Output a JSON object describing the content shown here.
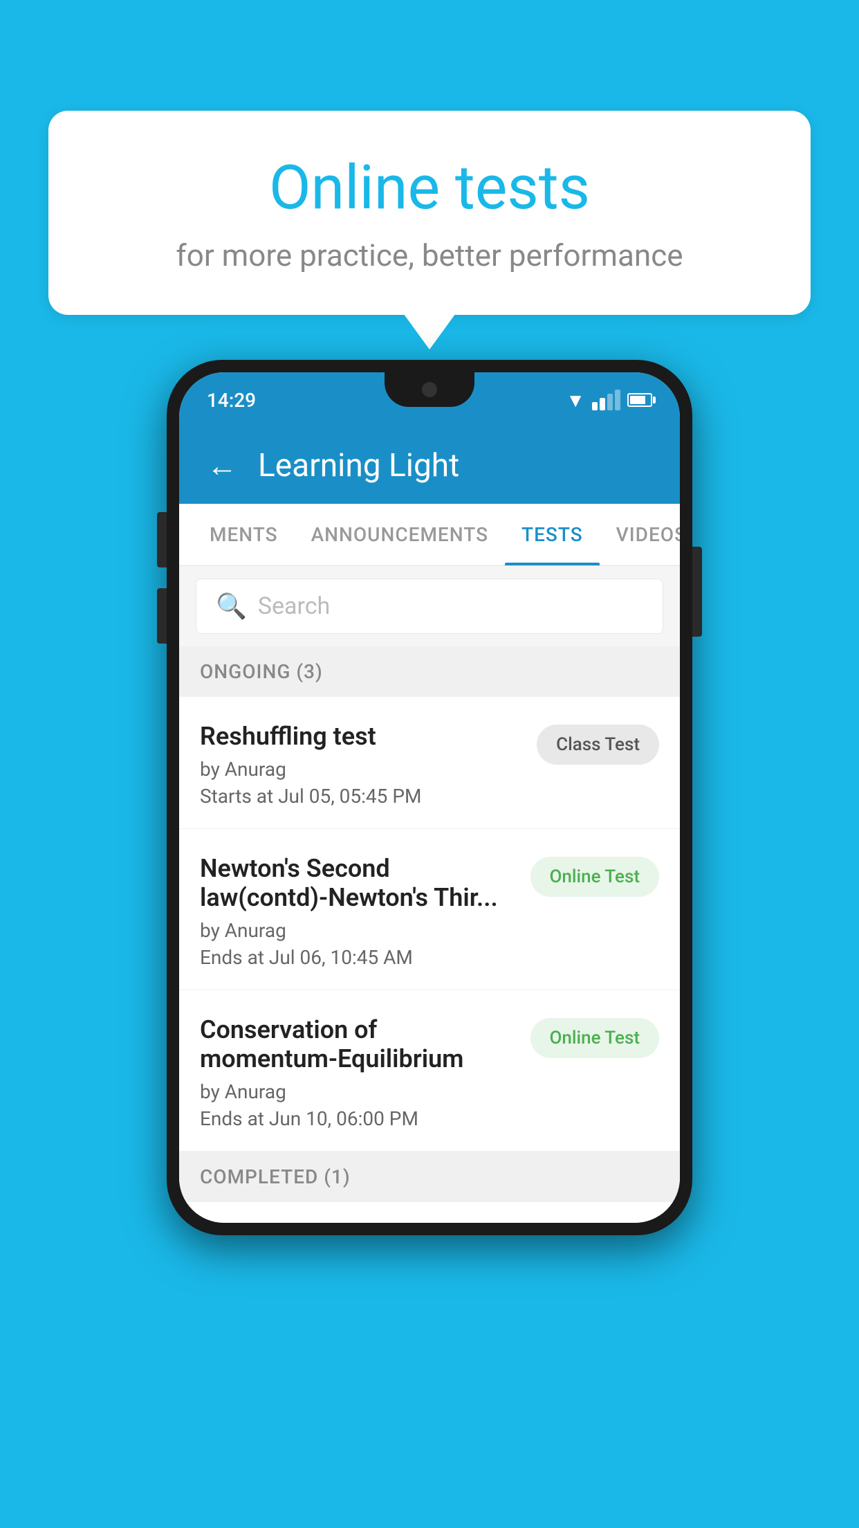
{
  "background_color": "#1ab8e8",
  "speech_bubble": {
    "title": "Online tests",
    "subtitle": "for more practice, better performance"
  },
  "phone": {
    "status_bar": {
      "time": "14:29"
    },
    "app_header": {
      "back_label": "←",
      "title": "Learning Light"
    },
    "tabs": [
      {
        "label": "MENTS",
        "active": false
      },
      {
        "label": "ANNOUNCEMENTS",
        "active": false
      },
      {
        "label": "TESTS",
        "active": true
      },
      {
        "label": "VIDEOS",
        "active": false
      }
    ],
    "search": {
      "placeholder": "Search"
    },
    "ongoing_section": {
      "label": "ONGOING (3)"
    },
    "tests": [
      {
        "name": "Reshuffling test",
        "by": "by Anurag",
        "time": "Starts at  Jul 05, 05:45 PM",
        "badge": "Class Test",
        "badge_type": "class"
      },
      {
        "name": "Newton's Second law(contd)-Newton's Thir...",
        "by": "by Anurag",
        "time": "Ends at  Jul 06, 10:45 AM",
        "badge": "Online Test",
        "badge_type": "online"
      },
      {
        "name": "Conservation of momentum-Equilibrium",
        "by": "by Anurag",
        "time": "Ends at  Jun 10, 06:00 PM",
        "badge": "Online Test",
        "badge_type": "online"
      }
    ],
    "completed_section": {
      "label": "COMPLETED (1)"
    }
  }
}
